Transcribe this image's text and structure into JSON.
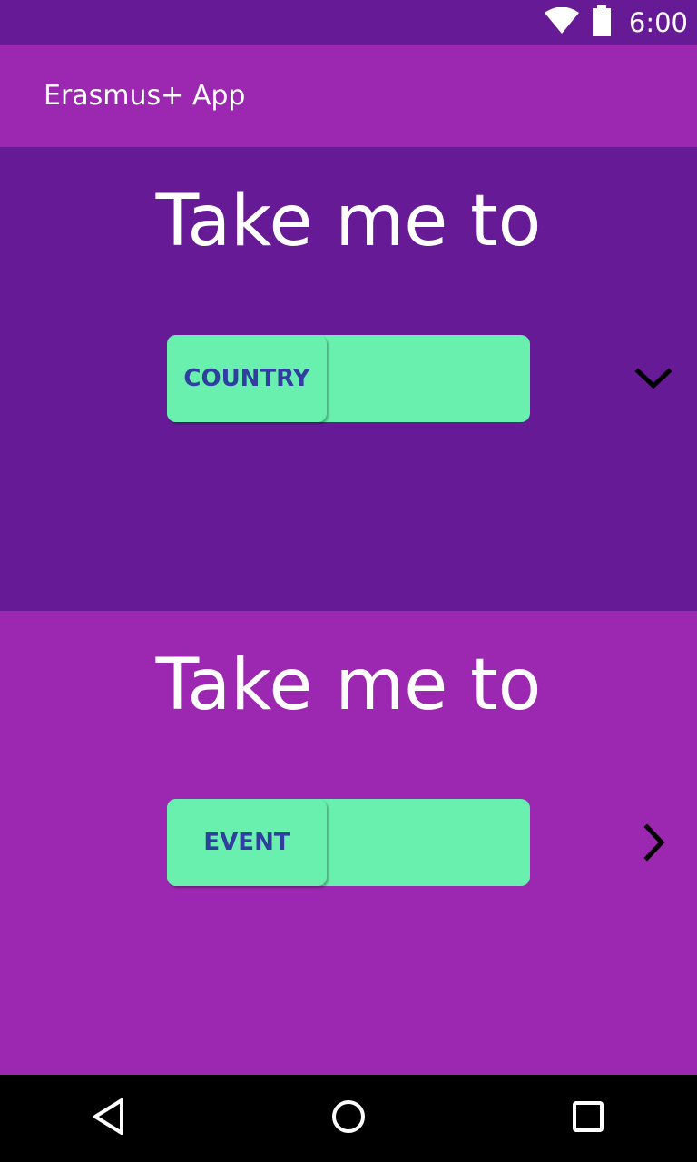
{
  "status_bar": {
    "time": "6:00",
    "icons": [
      "wifi-icon",
      "battery-icon"
    ],
    "background": "#661A96"
  },
  "app_bar": {
    "title": "Erasmus+ App",
    "background": "#9C27B0"
  },
  "sections": [
    {
      "heading": "Take me to",
      "selector_label": "COUNTRY",
      "selector_icon": "chevron-down-icon",
      "background": "#661A96"
    },
    {
      "heading": "Take me to",
      "selector_label": "EVENT",
      "selector_icon": "chevron-right-icon",
      "background": "#9C27B0"
    }
  ],
  "colors": {
    "accent": "#69F0AE",
    "label_text": "#303F9F"
  },
  "nav_bar": {
    "buttons": [
      "back-icon",
      "home-icon",
      "recents-icon"
    ]
  }
}
